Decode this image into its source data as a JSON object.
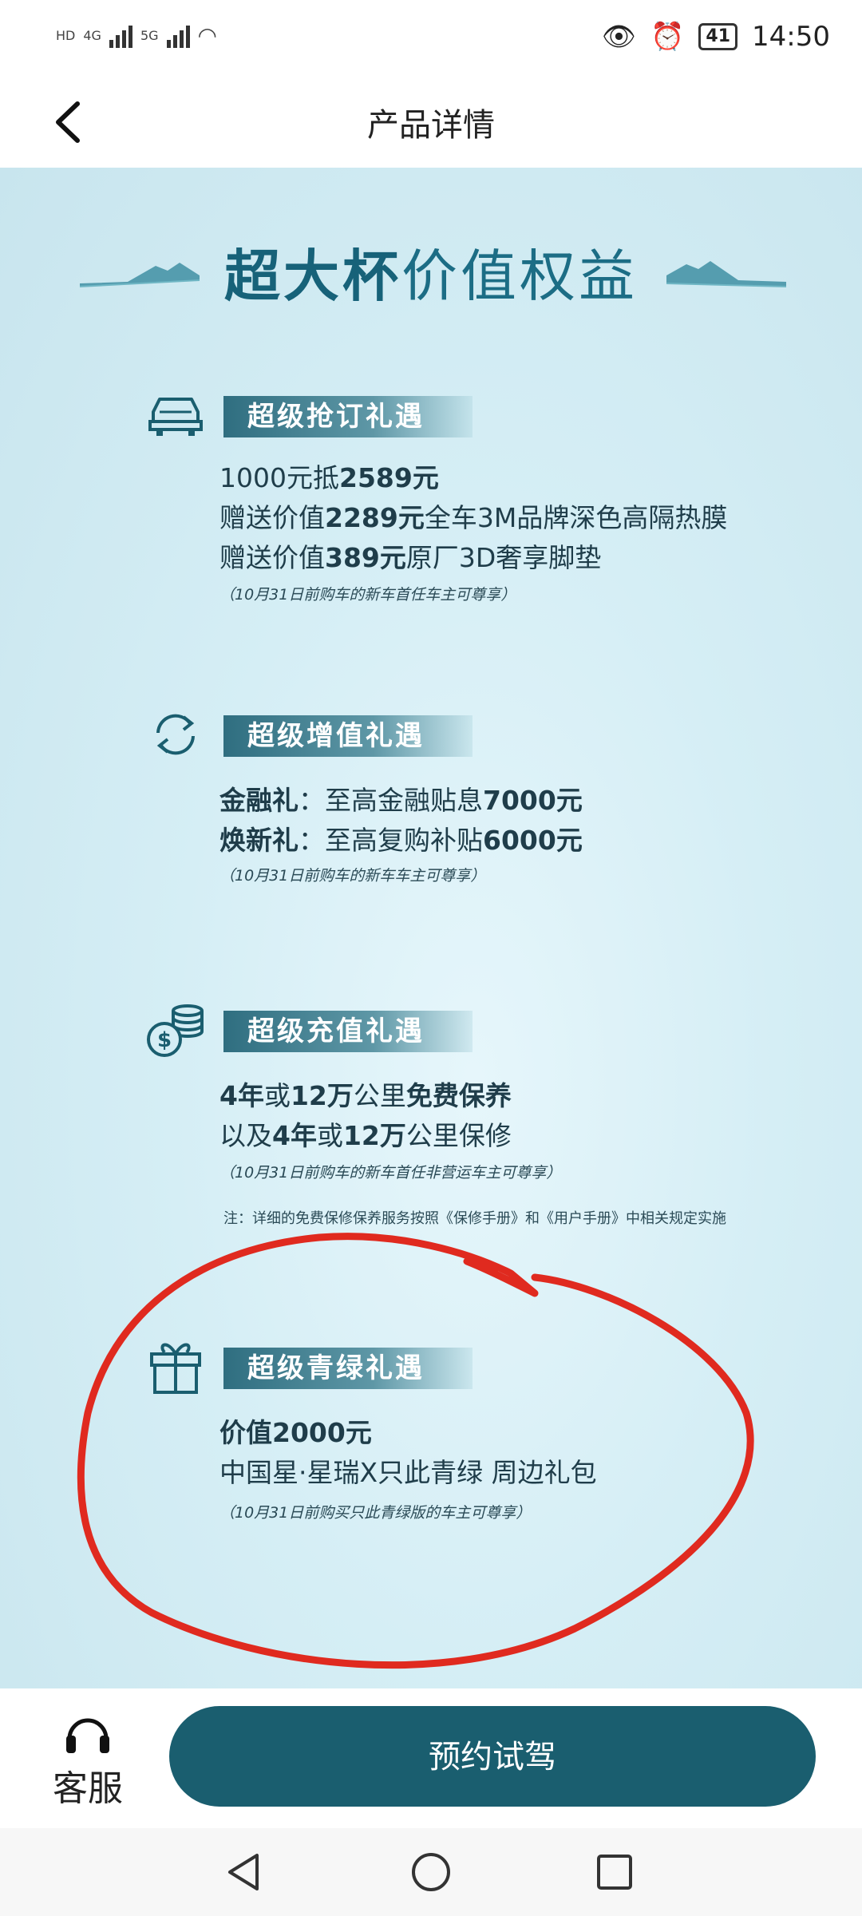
{
  "status_bar": {
    "left_labels": [
      "HD",
      "4G",
      "5G"
    ],
    "battery": "41",
    "time": "14:50"
  },
  "header": {
    "title": "产品详情"
  },
  "banner": {
    "title_bold": "超大杯",
    "title_rest": "价值权益"
  },
  "sections": [
    {
      "title": "超级抢订礼遇",
      "lines": [
        [
          "1000元抵",
          "2589元",
          ""
        ],
        [
          "赠送价值",
          "2289元",
          "全车3M品牌深色高隔热膜"
        ],
        [
          "赠送价值",
          "389元",
          "原厂3D奢享脚垫"
        ]
      ],
      "note": "（10月31日前购车的新车首任车主可尊享）"
    },
    {
      "title": "超级增值礼遇",
      "lines": [
        [
          "金融礼",
          "：至高金融贴息",
          "7000元"
        ],
        [
          "焕新礼",
          "：至高复购补贴",
          "6000元"
        ]
      ],
      "note": "（10月31日前购车的新车车主可尊享）"
    },
    {
      "title": "超级充值礼遇",
      "lines": [
        [
          "4年",
          "或",
          "12万",
          "公里",
          "免费保养"
        ],
        [
          "以及",
          "4年",
          "或",
          "12万",
          "公里保修"
        ]
      ],
      "note": "（10月31日前购车的新车首任非营运车主可尊享）",
      "footnote": "注：详细的免费保修保养服务按照《保修手册》和《用户手册》中相关规定实施"
    },
    {
      "title": "超级青绿礼遇",
      "lines": [
        [
          "价值2000元"
        ],
        [
          "中国星·星瑞X只此青绿 周边礼包"
        ]
      ],
      "note": "（10月31日前购买只此青绿版的车主可尊享）"
    }
  ],
  "actions": {
    "customer_service": "客服",
    "book_test_drive": "预约试驾"
  },
  "colors": {
    "accent": "#1a5e6f",
    "banner_text": "#1c6d85",
    "annotation": "#e02a1f",
    "content_bg": "#d5eef5"
  },
  "icons": [
    "back-arrow-icon",
    "car-icon",
    "refresh-icon",
    "coins-icon",
    "gift-icon",
    "headset-icon",
    "nav-back-icon",
    "nav-home-icon",
    "nav-recents-icon"
  ]
}
